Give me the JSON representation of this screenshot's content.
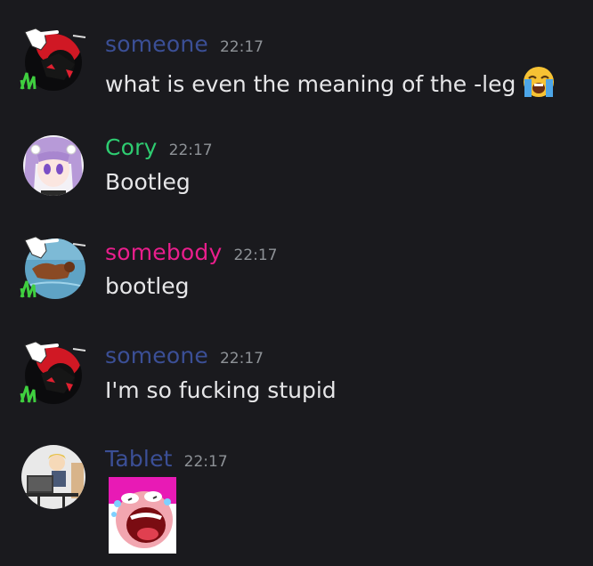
{
  "messages": [
    {
      "username": "someone",
      "username_color": "#3b4f96",
      "timestamp": "22:17",
      "text": "what is even the meaning of the -leg",
      "emoji": "loudly-crying-face-emoji",
      "avatar": "dark-character-avatar-with-pointing-hand"
    },
    {
      "username": "Cory",
      "username_color": "#2ecc71",
      "timestamp": "22:17",
      "text": "Bootleg",
      "avatar": "purple-haired-anime-girl-avatar"
    },
    {
      "username": "somebody",
      "username_color": "#e91e8c",
      "timestamp": "22:17",
      "text": "bootleg",
      "avatar": "dog-in-water-avatar-with-pointing-hand"
    },
    {
      "username": "someone",
      "username_color": "#3b4f96",
      "timestamp": "22:17",
      "text": "I'm so fucking stupid",
      "avatar": "dark-character-avatar-with-pointing-hand"
    },
    {
      "username": "Tablet",
      "username_color": "#3b4f96",
      "timestamp": "22:17",
      "text": "",
      "attachment": "laughing-crying-face-sticker",
      "avatar": "cartoon-man-at-desk-avatar"
    }
  ]
}
